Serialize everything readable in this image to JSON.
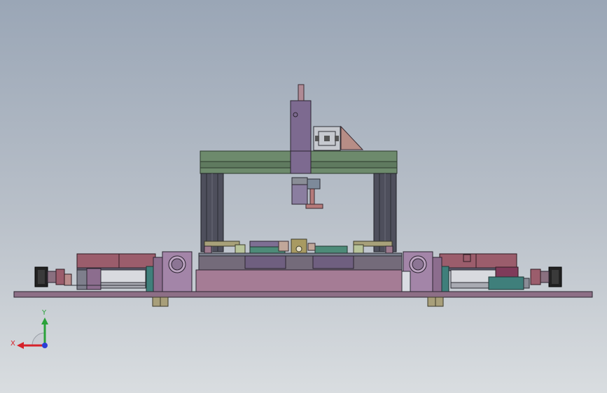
{
  "viewport": {
    "background_top": "#9aa6b6",
    "background_bottom": "#d9dde0"
  },
  "triad": {
    "x_label": "X",
    "y_label": "Y",
    "x_color": "#d6222a",
    "y_color": "#2aa23a",
    "z_color": "#2a3fd6"
  },
  "colors": {
    "base_plate": "#8d6f86",
    "frame_green": "#6d8a6c",
    "column_dark": "#4e4f5c",
    "mauve_block": "#a57c95",
    "purple_block": "#7f6c93",
    "rose_block": "#9b5d6c",
    "teal": "#3f7f7b"
  }
}
